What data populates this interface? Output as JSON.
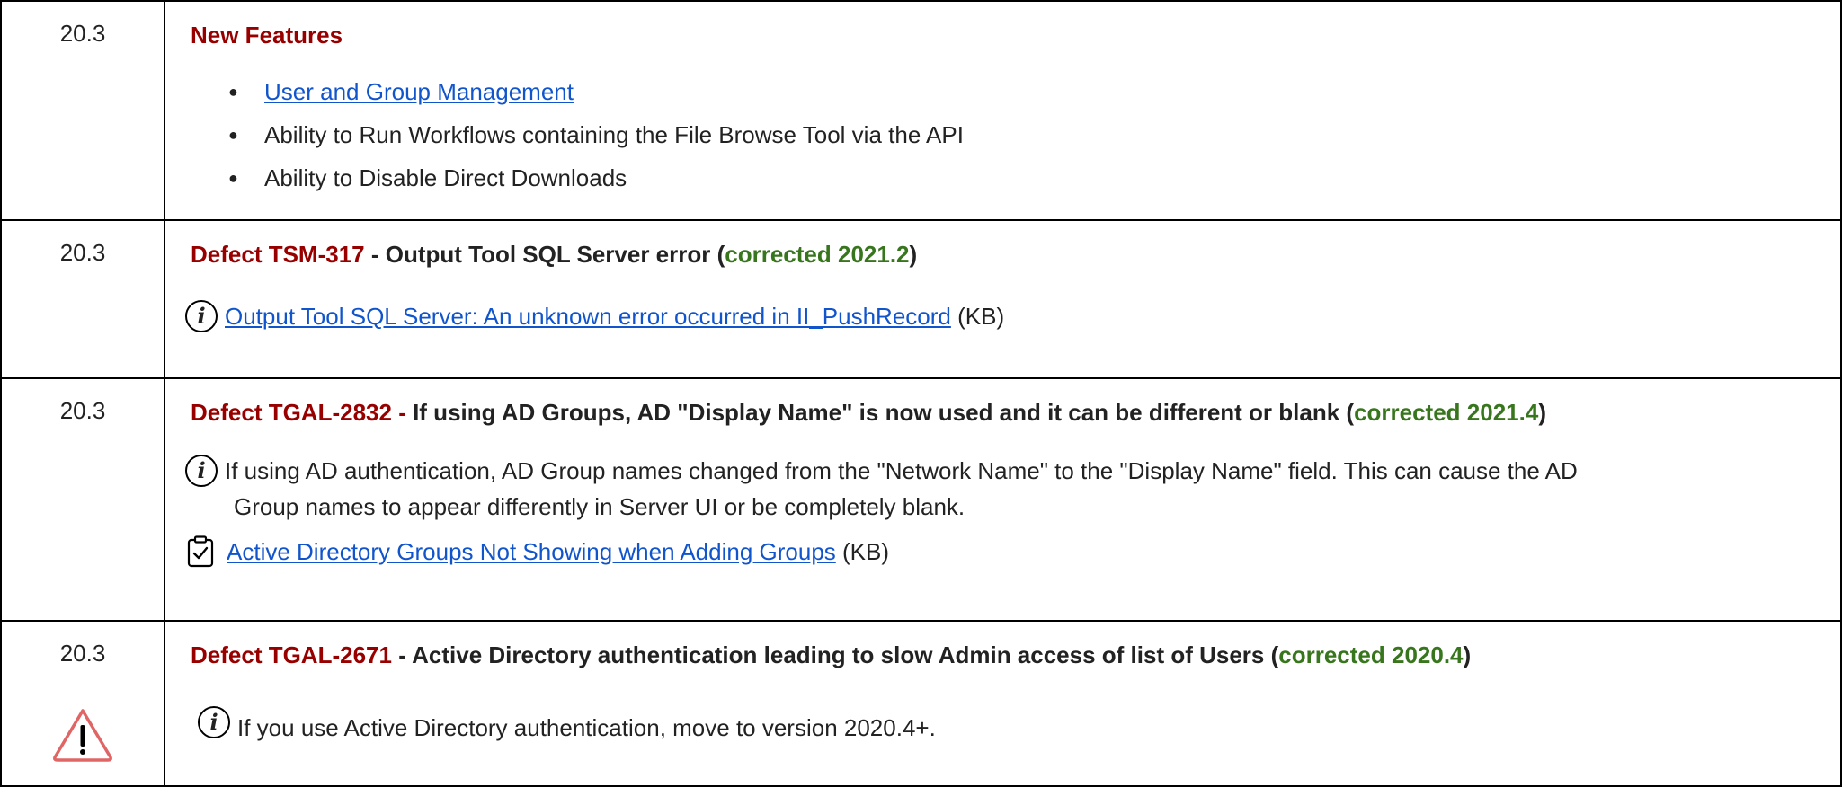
{
  "rows": [
    {
      "version": "20.3",
      "title": "New Features",
      "features": [
        {
          "text": "User and Group Management",
          "is_link": true
        },
        {
          "text": "Ability to Run Workflows containing the File Browse Tool via the API",
          "is_link": false
        },
        {
          "text": "Ability to Disable Direct Downloads",
          "is_link": false
        }
      ],
      "bullet": "●"
    },
    {
      "version": "20.3",
      "defect_label": "Defect TSM-317",
      "title_rest": " - Output Tool SQL Server error (",
      "corrected": "corrected 2021.2",
      "close_paren": ")",
      "info_link": "Output Tool SQL Server: An unknown error occurred in II_PushRecord",
      "info_suffix": " (KB)",
      "info_icon": "i"
    },
    {
      "version": "20.3",
      "defect_label": "Defect TGAL-2832",
      "dash": " - ",
      "title_rest": "If using AD Groups, AD \"Display Name\" is now used and it can be different or blank (",
      "corrected": "corrected 2021.4",
      "close_paren": ")",
      "info_text_line1": "If using AD authentication, AD Group names changed from the \"Network Name\" to the \"Display Name\" field. This can cause the AD",
      "info_text_line2": "Group names to appear differently in Server UI or be completely blank.",
      "kb_link": "Active Directory Groups Not Showing when Adding Groups",
      "kb_suffix": " (KB)",
      "info_icon": "i"
    },
    {
      "version": "20.3",
      "defect_label": "Defect TGAL-2671",
      "title_rest": " - Active Directory authentication leading to slow Admin access of list of Users (",
      "corrected": "corrected 2020.4",
      "close_paren": ")",
      "info_text": "If you use Active Directory authentication, move to version 2020.4+.",
      "info_icon": "i",
      "warning_icon": "warning-triangle-icon"
    }
  ],
  "colors": {
    "defect_red": "#980000",
    "corrected_green": "#38761d",
    "link_blue": "#1155cc",
    "warning_red": "#e06666"
  }
}
